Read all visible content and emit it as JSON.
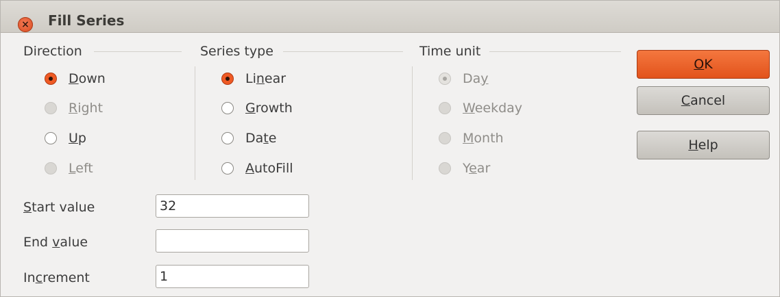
{
  "window": {
    "title": "Fill Series",
    "close_icon_glyph": "×"
  },
  "direction": {
    "title": "Direction",
    "options": [
      {
        "pre": "",
        "key": "D",
        "post": "own",
        "checked": true,
        "disabled": false
      },
      {
        "pre": "",
        "key": "R",
        "post": "ight",
        "checked": false,
        "disabled": true
      },
      {
        "pre": "",
        "key": "U",
        "post": "p",
        "checked": false,
        "disabled": false
      },
      {
        "pre": "",
        "key": "L",
        "post": "eft",
        "checked": false,
        "disabled": true
      }
    ]
  },
  "series_type": {
    "title": "Series type",
    "options": [
      {
        "pre": "Li",
        "key": "n",
        "post": "ear",
        "checked": true,
        "disabled": false
      },
      {
        "pre": "",
        "key": "G",
        "post": "rowth",
        "checked": false,
        "disabled": false
      },
      {
        "pre": "Da",
        "key": "t",
        "post": "e",
        "checked": false,
        "disabled": false
      },
      {
        "pre": "",
        "key": "A",
        "post": "utoFill",
        "checked": false,
        "disabled": false
      }
    ]
  },
  "time_unit": {
    "title": "Time unit",
    "options": [
      {
        "pre": "Da",
        "key": "y",
        "post": "",
        "checked": true,
        "disabled": true
      },
      {
        "pre": "",
        "key": "W",
        "post": "eekday",
        "checked": false,
        "disabled": true
      },
      {
        "pre": "",
        "key": "M",
        "post": "onth",
        "checked": false,
        "disabled": true
      },
      {
        "pre": "Y",
        "key": "e",
        "post": "ar",
        "checked": false,
        "disabled": true
      }
    ]
  },
  "fields": {
    "start": {
      "pre": "",
      "key": "S",
      "post": "tart value",
      "value": "32"
    },
    "end": {
      "pre": "End ",
      "key": "v",
      "post": "alue",
      "value": ""
    },
    "increment": {
      "pre": "In",
      "key": "c",
      "post": "rement",
      "value": "1"
    }
  },
  "buttons": {
    "ok": {
      "pre": "",
      "key": "O",
      "post": "K"
    },
    "cancel": {
      "pre": "",
      "key": "C",
      "post": "ancel"
    },
    "help": {
      "pre": "",
      "key": "H",
      "post": "elp"
    }
  },
  "colors": {
    "accent": "#e2531c",
    "dialog_bg": "#f2f1f0"
  }
}
